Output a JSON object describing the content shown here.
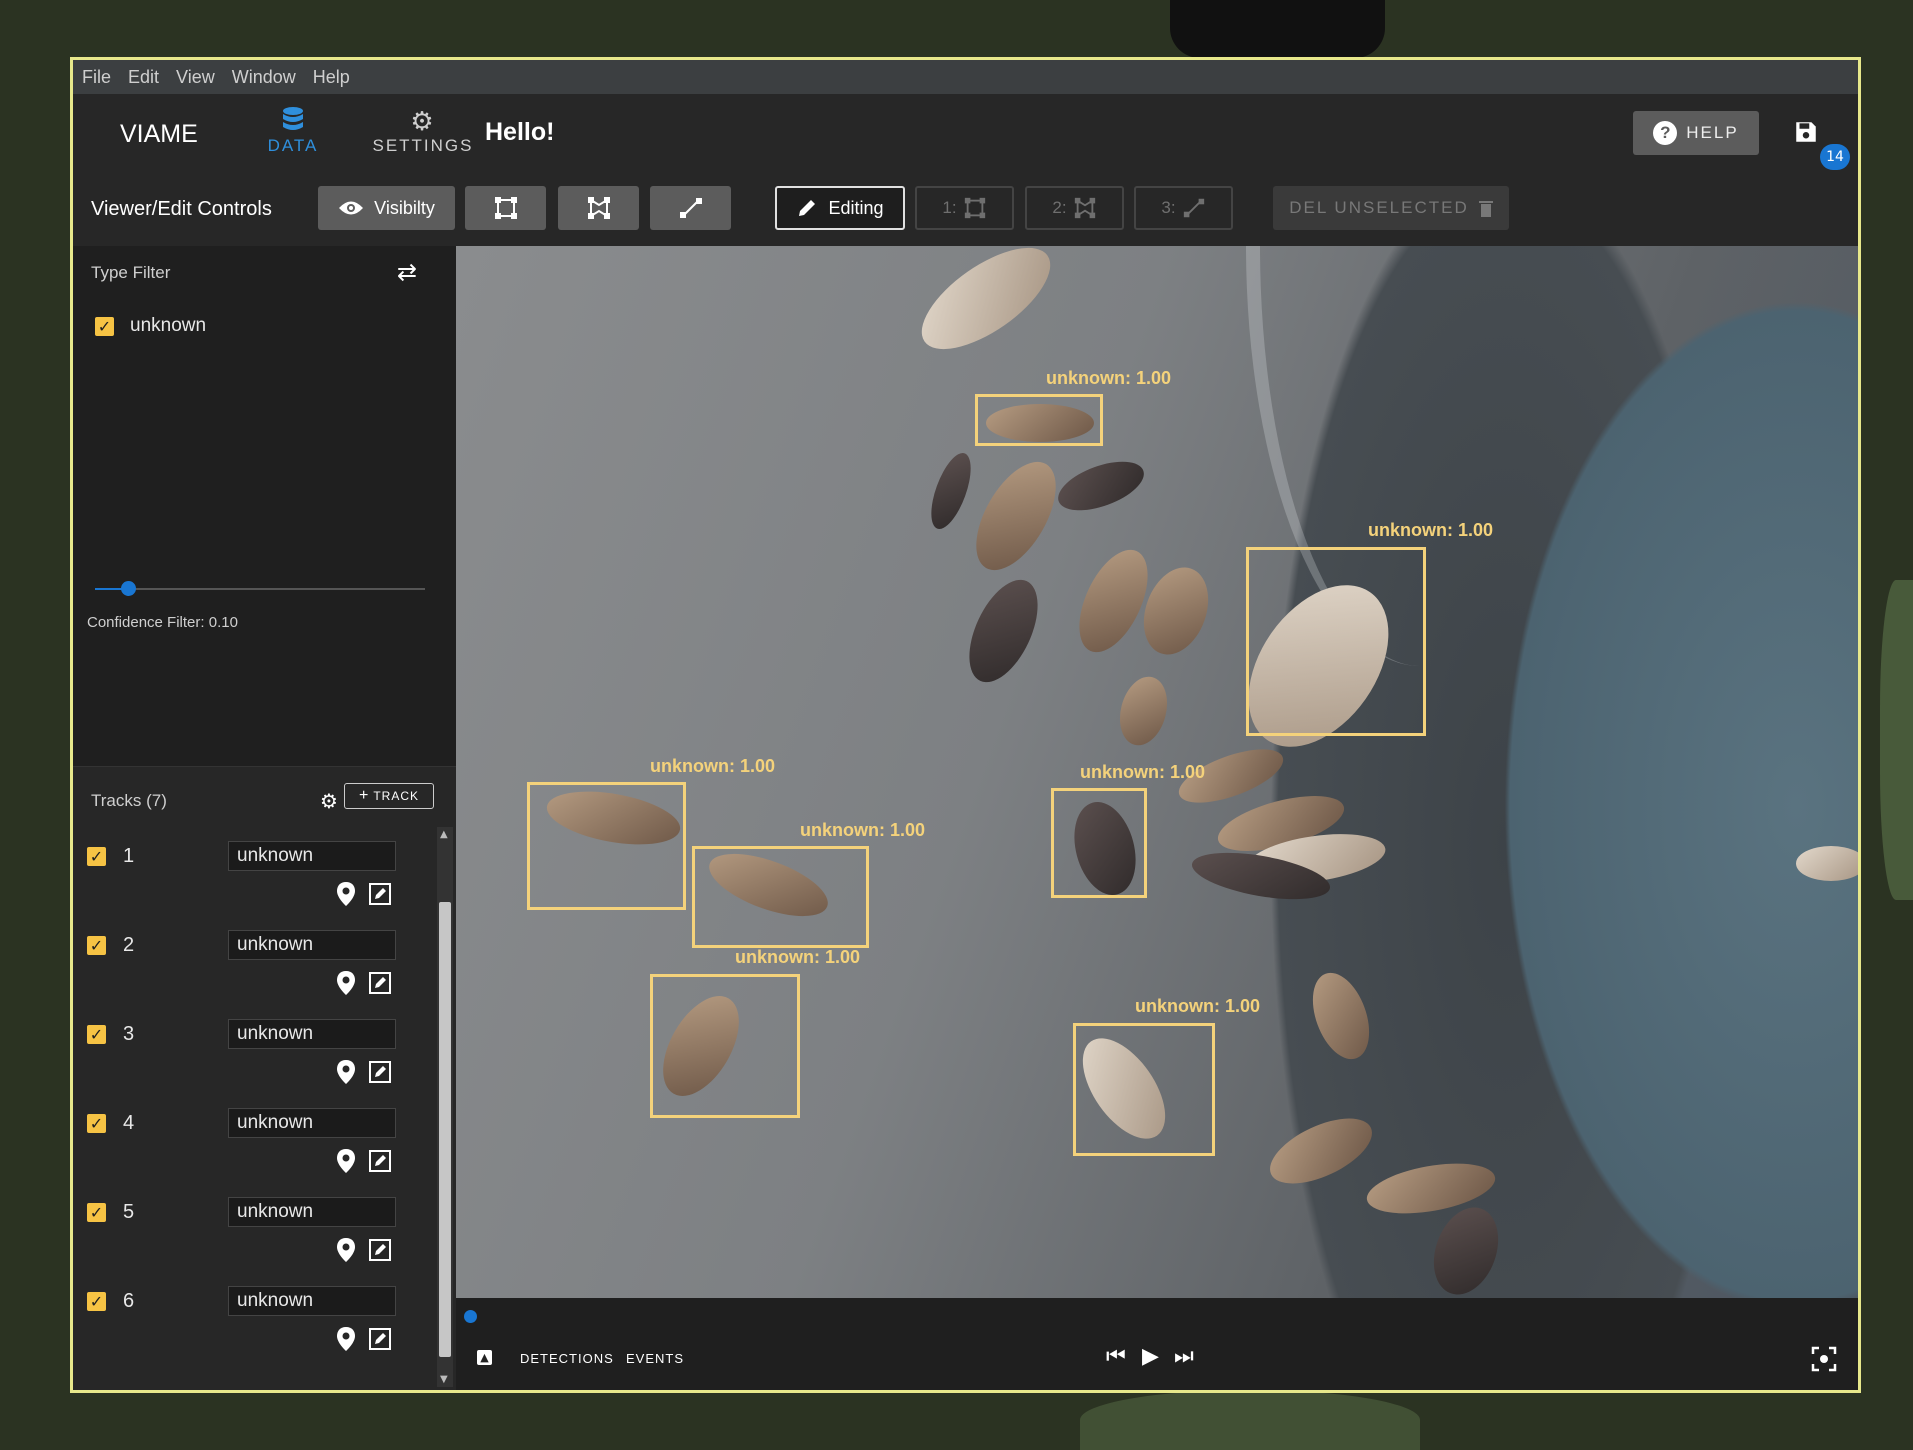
{
  "menu": [
    "File",
    "Edit",
    "View",
    "Window",
    "Help"
  ],
  "app": {
    "brand": "VIAME",
    "greeting": "Hello!",
    "save_badge": "14"
  },
  "nav": {
    "data_label": "DATA",
    "settings_label": "SETTINGS"
  },
  "help": {
    "label": "HELP"
  },
  "toolbar": {
    "label": "Viewer/Edit Controls",
    "visibility_label": "Visibilty",
    "editing_label": "Editing",
    "mode1": "1:",
    "mode2": "2:",
    "mode3": "3:",
    "delete_label": "DEL UNSELECTED"
  },
  "type_filter": {
    "title": "Type Filter",
    "items": [
      {
        "label": "unknown",
        "checked": true
      }
    ]
  },
  "confidence": {
    "label": "Confidence Filter: 0.10",
    "value": 0.1
  },
  "tracks": {
    "title": "Tracks (7)",
    "add_label": "TRACK",
    "items": [
      {
        "id": "1",
        "type": "unknown",
        "checked": true
      },
      {
        "id": "2",
        "type": "unknown",
        "checked": true
      },
      {
        "id": "3",
        "type": "unknown",
        "checked": true
      },
      {
        "id": "4",
        "type": "unknown",
        "checked": true
      },
      {
        "id": "5",
        "type": "unknown",
        "checked": true
      },
      {
        "id": "6",
        "type": "unknown",
        "checked": true
      }
    ]
  },
  "detections": [
    {
      "label": "unknown: 1.00"
    },
    {
      "label": "unknown: 1.00"
    },
    {
      "label": "unknown: 1.00"
    },
    {
      "label": "unknown: 1.00"
    },
    {
      "label": "unknown: 1.00"
    },
    {
      "label": "unknown: 1.00"
    },
    {
      "label": "unknown: 1.00"
    }
  ],
  "bottom": {
    "detections_tab": "DETECTIONS",
    "events_tab": "EVENTS"
  },
  "colors": {
    "accent": "#1976d2",
    "annotation": "#f4d27b",
    "checkbox": "#f6c344",
    "window_border": "#e7e88b"
  }
}
